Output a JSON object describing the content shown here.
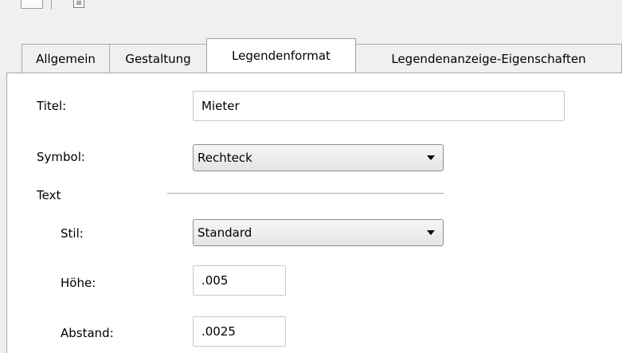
{
  "tabs": [
    {
      "label": "Allgemein"
    },
    {
      "label": "Gestaltung"
    },
    {
      "label": "Legendenformat"
    },
    {
      "label": "Legendenanzeige-Eigenschaften"
    }
  ],
  "active_tab": "Legendenformat",
  "form": {
    "titel_label": "Titel:",
    "titel_value": "Mieter",
    "symbol_label": "Symbol:",
    "symbol_value": "Rechteck",
    "text_section": "Text",
    "stil_label": "Stil:",
    "stil_value": "Standard",
    "hoehe_label": "Höhe:",
    "hoehe_value": ".005",
    "abstand_label": "Abstand:",
    "abstand_value": ".0025"
  },
  "icons": {
    "toolbar_left": "layout-icon",
    "toolbar_right": "dialog-icon",
    "dropdown": "chevron-down-icon"
  }
}
